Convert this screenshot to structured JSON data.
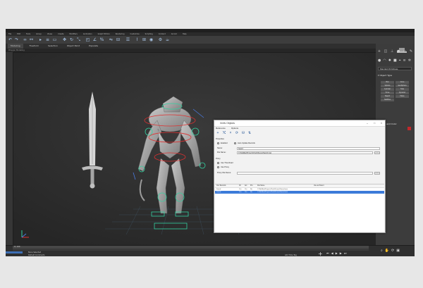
{
  "app": {
    "menu_items": [
      "File",
      "Edit",
      "Tools",
      "Group",
      "Views",
      "Create",
      "Modifiers",
      "Animation",
      "Graph Editors",
      "Rendering",
      "Customize",
      "Scripting",
      "Content",
      "Arnold",
      "Help"
    ],
    "ribbon_tabs": [
      "Modeling",
      "Freeform",
      "Selection",
      "Object Paint",
      "Populate"
    ],
    "ribbon_sub": "Polygon Modeling",
    "viewport_label": "[+] [Perspective] [Standard] [Default Shading]"
  },
  "command_panel": {
    "dropdown": "Standard Primitives",
    "object_type_title": "Object Type",
    "buttons": [
      "Box",
      "Cone",
      "Sphere",
      "GeoSphere",
      "Cylinder",
      "Tube",
      "Torus",
      "Pyramid",
      "Teapot",
      "Plane",
      "TextPlus"
    ],
    "name_color_title": "Name and Color"
  },
  "dialog": {
    "title": "Xrefs Objects",
    "menus": [
      "Reference",
      "Options"
    ],
    "properties_label": "Properties",
    "enabled_label": "Enabled",
    "auto_update_label": "Auto Update Records",
    "name_label": "Name:",
    "name_value": "Sword",
    "file_name_label": "File Name:",
    "file_name_value": "C:\\3dsMax\\Projects\\Xrefs\\Scene\\Sword.max",
    "proxy_label": "Proxy",
    "proxy_option1": "Use Thumbnail",
    "proxy_option2": "Use Proxy",
    "proxy_file_label": "Proxy File Name:",
    "table_headers": [
      "Xref Records",
      "Ch",
      "Ani",
      "Pro",
      "File Name",
      "Use as Parent"
    ],
    "rows": [
      {
        "name": "Sword",
        "c1": "Yes",
        "c2": "Yes",
        "c3": "No",
        "file": "C:\\3dsMax\\Projects\\Xrefs\\Scene\\Sword.max",
        "selected": false
      },
      {
        "name": "Sword",
        "c1": "Yes",
        "c2": "Yes",
        "c3": "No",
        "file": "C:\\3dsMax\\Projects\\Xrefs\\Scene\\Sword.max",
        "selected": true
      }
    ]
  },
  "status": {
    "selection": "None Selected",
    "prompt": "Default Comments",
    "frame": "0 / 100",
    "add_time_tag": "Add Time Tag"
  },
  "colors": {
    "accent": "#3c7bd9",
    "rig_green": "#33d0a0",
    "rig_red": "#e03030",
    "rig_blue": "#4a7ae0"
  }
}
